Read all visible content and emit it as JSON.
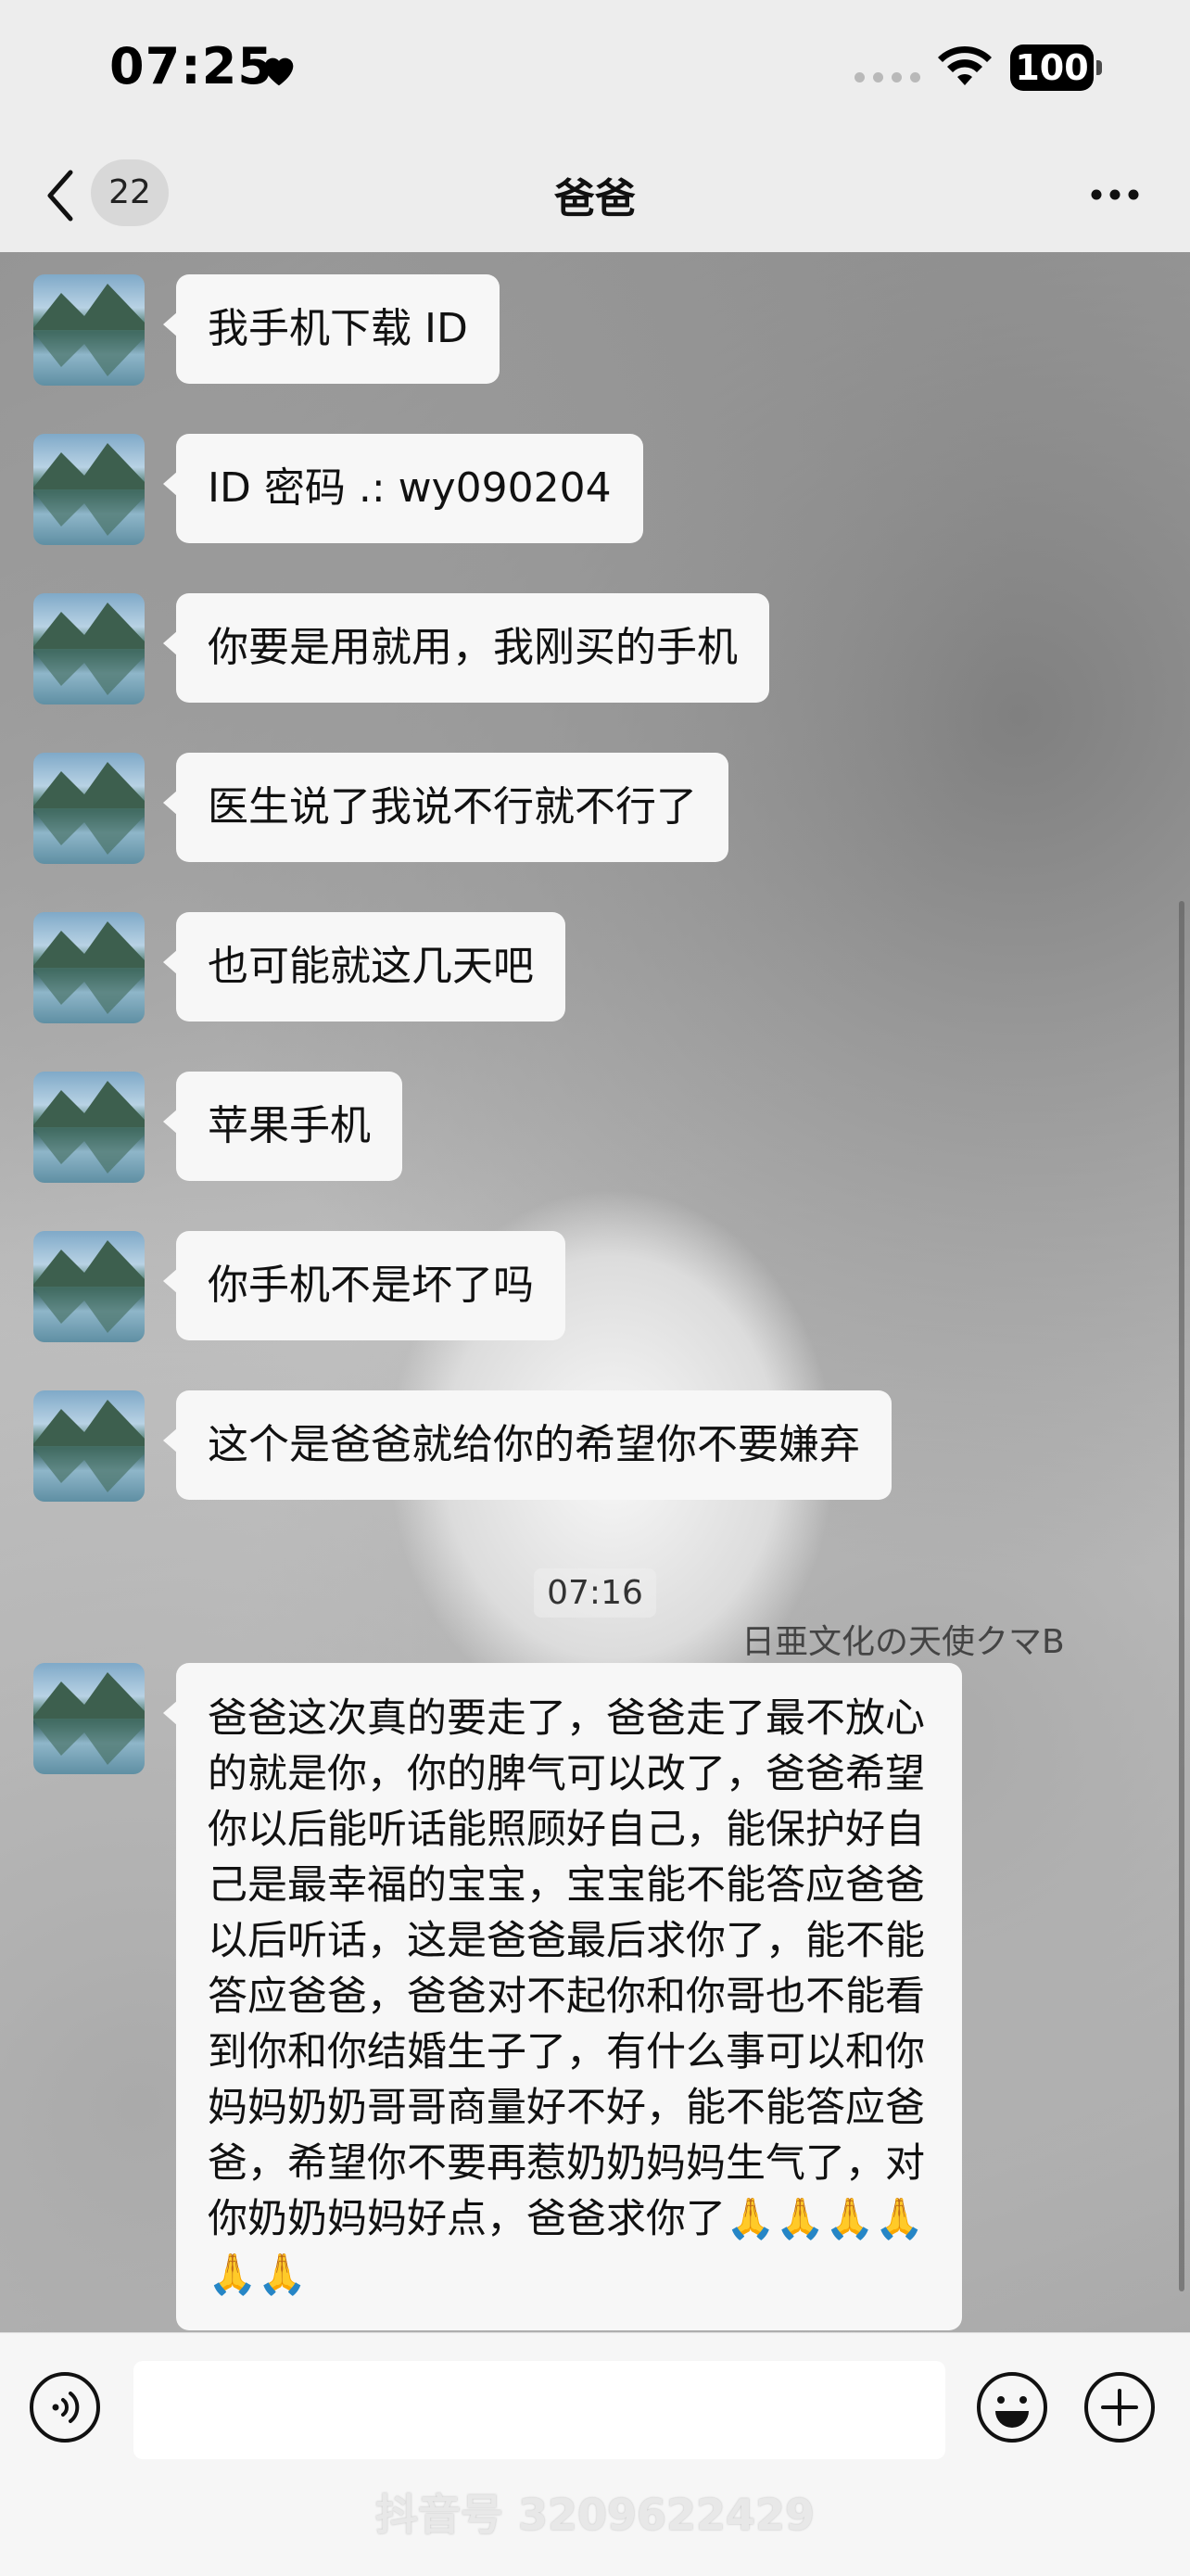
{
  "status_bar": {
    "time": "07:25",
    "battery": "100"
  },
  "navbar": {
    "unread_count": "22",
    "title": "爸爸"
  },
  "messages": [
    {
      "text": "我手机下载 ID"
    },
    {
      "text": "ID 密码 .: wy090204"
    },
    {
      "text": "你要是用就用，我刚买的手机"
    },
    {
      "text": "医生说了我说不行就不行了"
    },
    {
      "text": "也可能就这几天吧"
    },
    {
      "text": "苹果手机"
    },
    {
      "text": "你手机不是坏了吗"
    },
    {
      "text": "这个是爸爸就给你的希望你不要嫌弃"
    }
  ],
  "timestamp": "07:16",
  "background_art_text": "日亜文化の天使クマB",
  "long_message": "爸爸这次真的要走了，爸爸走了最不放心的就是你，你的脾气可以改了，爸爸希望你以后能听话能照顾好自己，能保护好自己是最幸福的宝宝，宝宝能不能答应爸爸以后听话，这是爸爸最后求你了，能不能答应爸爸，爸爸对不起你和你哥也不能看到你和你结婚生子了，有什么事可以和你妈妈奶奶哥哥商量好不好，能不能答应爸爸，希望你不要再惹奶奶妈妈生气了，对你奶奶妈妈好点，爸爸求你了🙏🙏🙏🙏🙏🙏",
  "watermark": "抖音号 3209622429",
  "colors": {
    "bubble": "#f7f7f7",
    "bar": "#ededed"
  }
}
